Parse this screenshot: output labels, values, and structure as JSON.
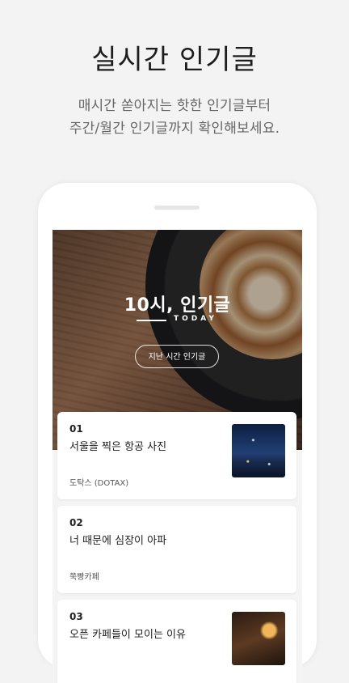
{
  "header": {
    "title": "실시간 인기글",
    "subtitle_line1": "매시간 쏟아지는 핫한 인기글부터",
    "subtitle_line2": "주간/월간 인기글까지 확인해보세요."
  },
  "hero": {
    "title": "10시, 인기글",
    "subtitle": "TODAY",
    "button_label": "지난 시간 인기글"
  },
  "posts": [
    {
      "rank": "01",
      "title": "서울을 찍은 항공 사진",
      "source": "도탁스 (DOTAX)",
      "thumbnail": "night-city-photo"
    },
    {
      "rank": "02",
      "title": "너 때문에 심장이 아파",
      "source": "쭉빵카페",
      "thumbnail": ""
    },
    {
      "rank": "03",
      "title": "오픈 카페들이 모이는 이유",
      "source": "",
      "thumbnail": "coffee-photo"
    }
  ]
}
